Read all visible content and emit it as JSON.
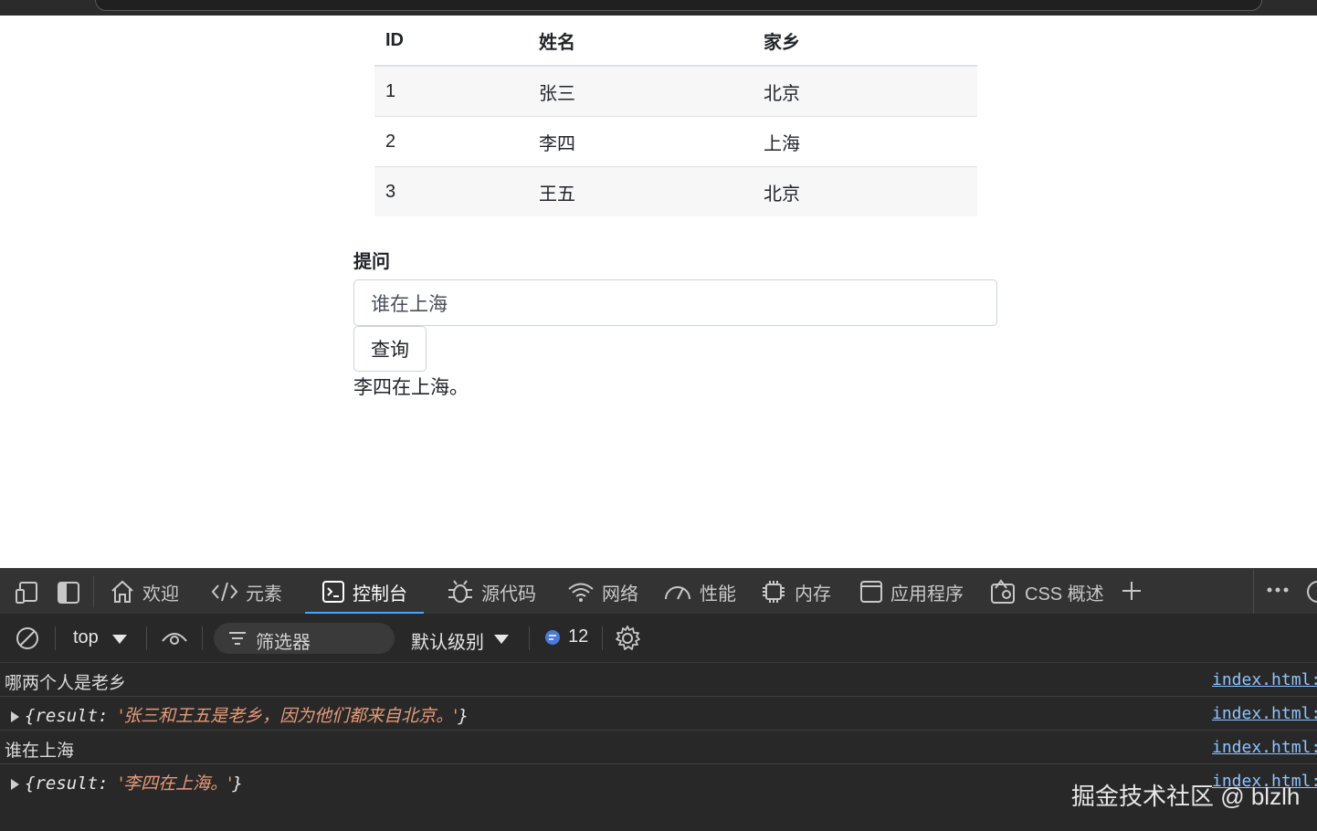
{
  "table": {
    "headers": [
      "ID",
      "姓名",
      "家乡"
    ],
    "rows": [
      [
        "1",
        "张三",
        "北京"
      ],
      [
        "2",
        "李四",
        "上海"
      ],
      [
        "3",
        "王五",
        "北京"
      ]
    ]
  },
  "form": {
    "label": "提问",
    "input_value": "谁在上海",
    "button_label": "查询",
    "answer": "李四在上海。"
  },
  "devtools": {
    "tabs": [
      "欢迎",
      "元素",
      "控制台",
      "源代码",
      "网络",
      "性能",
      "内存",
      "应用程序",
      "CSS 概述"
    ],
    "active_tab": "控制台",
    "toolbar": {
      "context": "top",
      "filter_placeholder": "筛选器",
      "level": "默认级别",
      "message_count": "12"
    },
    "console": [
      {
        "text": "哪两个人是老乡",
        "source": "index.html:"
      },
      {
        "key": "{result: ",
        "value": "'张三和王五是老乡，因为他们都来自北京。'",
        "close": "}",
        "source": "index.html:"
      },
      {
        "text": "谁在上海",
        "source": "index.html:"
      },
      {
        "key": "{result: ",
        "value": "'李四在上海。'",
        "close": "}",
        "source": "index.html:"
      }
    ]
  },
  "watermark": "掘金技术社区 @ blzlh",
  "colors": {
    "accent": "#4aa3ff",
    "devtools_bg": "#282828",
    "string": "#e59a7a",
    "link": "#8fc4ff"
  }
}
